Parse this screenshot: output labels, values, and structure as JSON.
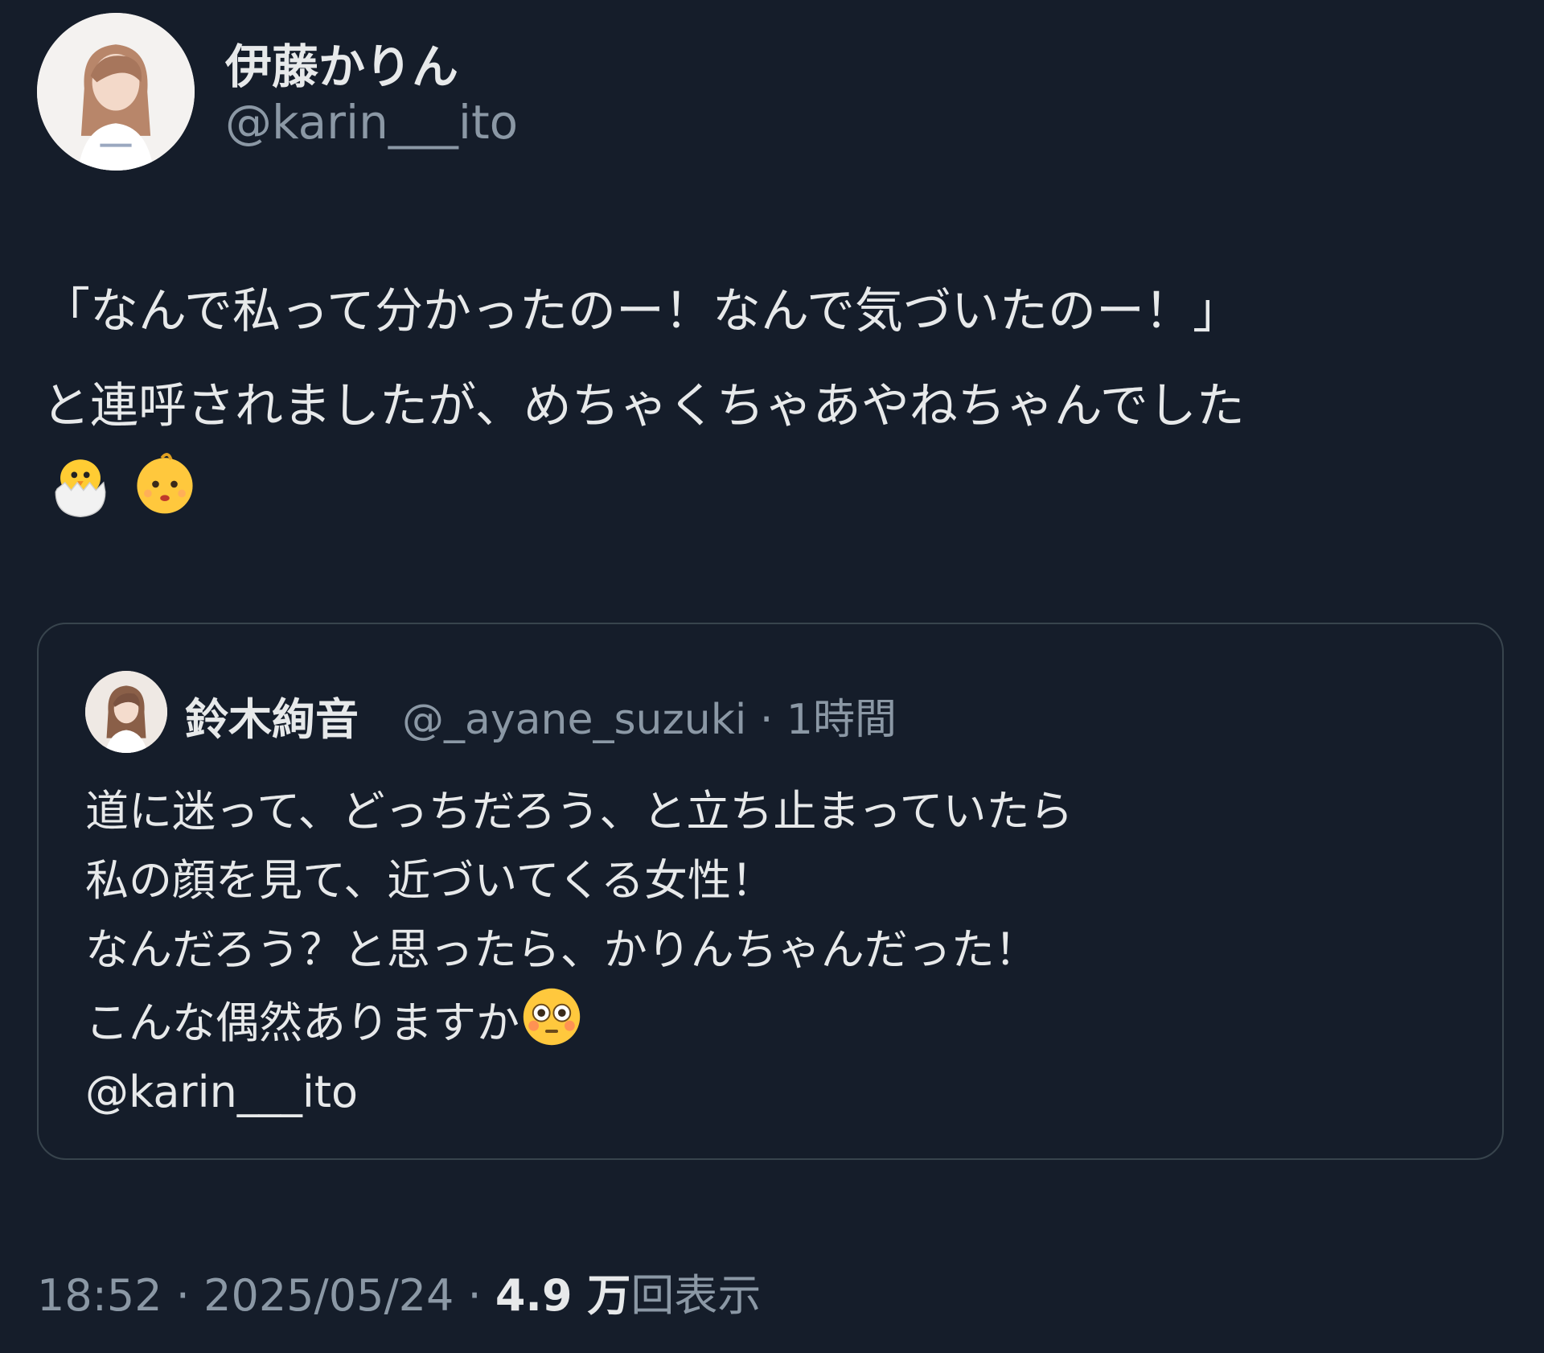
{
  "author": {
    "display_name": "伊藤かりん",
    "handle": "@karin___ito",
    "avatar_icon": "avatar-photo-icon"
  },
  "tweet": {
    "lines": [
      "「なんで私って分かったのー！なんで気づいたのー！」",
      "と連呼されましたが、めちゃくちゃあやねちゃんでした"
    ],
    "emojis": [
      "hatching-chick-icon",
      "baby-icon"
    ]
  },
  "quoted": {
    "display_name": "鈴木絢音",
    "handle_time": "@_ayane_suzuki · 1時間",
    "lines": [
      "道に迷って、どっちだろう、と立ち止まっていたら",
      "私の顔を見て、近づいてくる女性！",
      "なんだろう？と思ったら、かりんちゃんだった！",
      "こんな偶然ありますか",
      "@karin___ito"
    ],
    "emoji": "flushed-face-icon"
  },
  "meta": {
    "time_date": "18:52 · 2025/05/24 · ",
    "views_number": "4.9 万",
    "views_label": "回表示"
  },
  "colors": {
    "background": "#151d2a",
    "text": "#e7e9ea",
    "muted": "#8b98a5",
    "border": "#38444d"
  }
}
